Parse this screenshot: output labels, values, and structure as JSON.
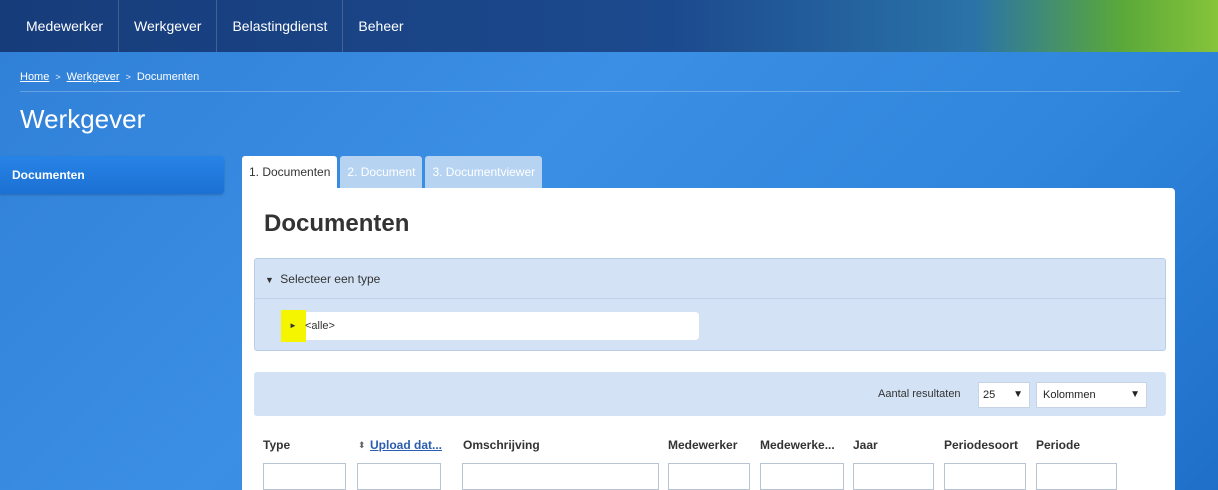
{
  "nav": {
    "items": [
      "Medewerker",
      "Werkgever",
      "Belastingdienst",
      "Beheer"
    ]
  },
  "breadcrumb": {
    "home": "Home",
    "sep": ">",
    "werkgever": "Werkgever",
    "current": "Documenten"
  },
  "page": {
    "title": "Werkgever"
  },
  "sidebar": {
    "items": [
      {
        "label": "Documenten"
      }
    ]
  },
  "tabs": [
    {
      "label": "1. Documenten"
    },
    {
      "label": "2. Document"
    },
    {
      "label": "3. Documentviewer"
    }
  ],
  "panel": {
    "title": "Documenten",
    "filter": {
      "toggle_glyph": "▼",
      "header": "Selecteer een type",
      "tree_arrow": "►",
      "selected": "<alle>"
    },
    "results": {
      "label": "Aantal resultaten",
      "page_size": "25",
      "columns_label": "Kolommen",
      "caret": "▼"
    },
    "columns": [
      {
        "label": "Type"
      },
      {
        "label": "Upload dat..."
      },
      {
        "label": "Omschrijving"
      },
      {
        "label": "Medewerker"
      },
      {
        "label": "Medewerke..."
      },
      {
        "label": "Jaar"
      },
      {
        "label": "Periodesoort"
      },
      {
        "label": "Periode"
      }
    ]
  },
  "colors": {
    "nav_bg": "#173c7a",
    "accent": "#1c70d3",
    "highlight": "#f5f500",
    "filter_bg": "#d3e3f5"
  },
  "icons": {
    "sort": "sort-icon",
    "tree_arrow": "triangle-right-icon",
    "collapse": "triangle-down-icon"
  }
}
